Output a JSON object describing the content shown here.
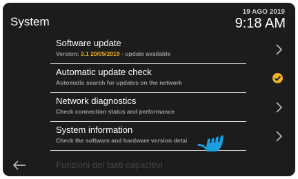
{
  "header": {
    "title": "System",
    "date": "19 AGO 2019",
    "time": "9:18 AM"
  },
  "menu": {
    "items": [
      {
        "label": "Software update",
        "desc_prefix": "Version: ",
        "desc_highlight": "3.1 20/05/2019",
        "desc_suffix": " - update available",
        "indicator": "chevron-right-icon"
      },
      {
        "label": "Automatic update check",
        "desc": "Automatic search for updates on the network",
        "indicator": "checkmark-icon"
      },
      {
        "label": "Network diagnostics",
        "desc": "Check connection status and performance",
        "indicator": "chevron-right-icon"
      },
      {
        "label": "System information",
        "desc": "Check the software and hardware version detai",
        "indicator": "chevron-right-icon"
      }
    ],
    "partial_item_label": "Funzioni dei tasti capacitivi"
  },
  "colors": {
    "accent": "#f0b429",
    "background": "#1c1c1c",
    "text": "#ffffff",
    "secondary_text": "#9a9a9a",
    "cursor": "#1aa0e0"
  },
  "icons": {
    "back": "back-arrow-icon",
    "pointer": "hand-pointer-icon"
  }
}
